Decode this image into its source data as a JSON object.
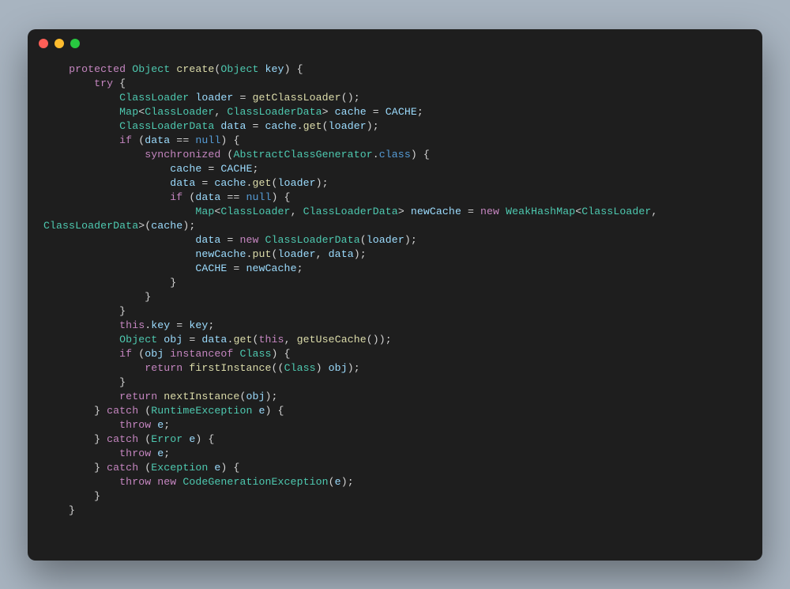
{
  "window": {
    "traffic_lights": [
      "close",
      "minimize",
      "zoom"
    ]
  },
  "code": {
    "language": "java",
    "tokens": [
      [
        [
          "    ",
          "pun"
        ],
        [
          "protected",
          "kw"
        ],
        [
          " ",
          "pun"
        ],
        [
          "Object",
          "type"
        ],
        [
          " ",
          "pun"
        ],
        [
          "create",
          "fn"
        ],
        [
          "(",
          "pun"
        ],
        [
          "Object",
          "type"
        ],
        [
          " ",
          "pun"
        ],
        [
          "key",
          "var"
        ],
        [
          ") {",
          "pun"
        ]
      ],
      [
        [
          "        ",
          "pun"
        ],
        [
          "try",
          "kw"
        ],
        [
          " {",
          "pun"
        ]
      ],
      [
        [
          "            ",
          "pun"
        ],
        [
          "ClassLoader",
          "type"
        ],
        [
          " ",
          "pun"
        ],
        [
          "loader",
          "var"
        ],
        [
          " = ",
          "pun"
        ],
        [
          "getClassLoader",
          "fn"
        ],
        [
          "();",
          "pun"
        ]
      ],
      [
        [
          "            ",
          "pun"
        ],
        [
          "Map",
          "type"
        ],
        [
          "<",
          "pun"
        ],
        [
          "ClassLoader",
          "type"
        ],
        [
          ", ",
          "pun"
        ],
        [
          "ClassLoaderData",
          "type"
        ],
        [
          "> ",
          "pun"
        ],
        [
          "cache",
          "var"
        ],
        [
          " = ",
          "pun"
        ],
        [
          "CACHE",
          "cnst"
        ],
        [
          ";",
          "pun"
        ]
      ],
      [
        [
          "            ",
          "pun"
        ],
        [
          "ClassLoaderData",
          "type"
        ],
        [
          " ",
          "pun"
        ],
        [
          "data",
          "var"
        ],
        [
          " = ",
          "pun"
        ],
        [
          "cache",
          "var"
        ],
        [
          ".",
          "pun"
        ],
        [
          "get",
          "fn"
        ],
        [
          "(",
          "pun"
        ],
        [
          "loader",
          "var"
        ],
        [
          ");",
          "pun"
        ]
      ],
      [
        [
          "            ",
          "pun"
        ],
        [
          "if",
          "kw"
        ],
        [
          " (",
          "pun"
        ],
        [
          "data",
          "var"
        ],
        [
          " == ",
          "pun"
        ],
        [
          "null",
          "null"
        ],
        [
          ") {",
          "pun"
        ]
      ],
      [
        [
          "                ",
          "pun"
        ],
        [
          "synchronized",
          "kw"
        ],
        [
          " (",
          "pun"
        ],
        [
          "AbstractClassGenerator",
          "type"
        ],
        [
          ".",
          "pun"
        ],
        [
          "class",
          "null"
        ],
        [
          ") {",
          "pun"
        ]
      ],
      [
        [
          "                    ",
          "pun"
        ],
        [
          "cache",
          "var"
        ],
        [
          " = ",
          "pun"
        ],
        [
          "CACHE",
          "cnst"
        ],
        [
          ";",
          "pun"
        ]
      ],
      [
        [
          "                    ",
          "pun"
        ],
        [
          "data",
          "var"
        ],
        [
          " = ",
          "pun"
        ],
        [
          "cache",
          "var"
        ],
        [
          ".",
          "pun"
        ],
        [
          "get",
          "fn"
        ],
        [
          "(",
          "pun"
        ],
        [
          "loader",
          "var"
        ],
        [
          ");",
          "pun"
        ]
      ],
      [
        [
          "                    ",
          "pun"
        ],
        [
          "if",
          "kw"
        ],
        [
          " (",
          "pun"
        ],
        [
          "data",
          "var"
        ],
        [
          " == ",
          "pun"
        ],
        [
          "null",
          "null"
        ],
        [
          ") {",
          "pun"
        ]
      ],
      [
        [
          "                        ",
          "pun"
        ],
        [
          "Map",
          "type"
        ],
        [
          "<",
          "pun"
        ],
        [
          "ClassLoader",
          "type"
        ],
        [
          ", ",
          "pun"
        ],
        [
          "ClassLoaderData",
          "type"
        ],
        [
          "> ",
          "pun"
        ],
        [
          "newCache",
          "var"
        ],
        [
          " = ",
          "pun"
        ],
        [
          "new",
          "kw"
        ],
        [
          " ",
          "pun"
        ],
        [
          "WeakHashMap",
          "type"
        ],
        [
          "<",
          "pun"
        ],
        [
          "ClassLoader",
          "type"
        ],
        [
          ", ",
          "pun"
        ]
      ],
      [
        [
          "ClassLoaderData",
          "type"
        ],
        [
          ">(",
          "pun"
        ],
        [
          "cache",
          "var"
        ],
        [
          ");",
          "pun"
        ]
      ],
      [
        [
          "                        ",
          "pun"
        ],
        [
          "data",
          "var"
        ],
        [
          " = ",
          "pun"
        ],
        [
          "new",
          "kw"
        ],
        [
          " ",
          "pun"
        ],
        [
          "ClassLoaderData",
          "type"
        ],
        [
          "(",
          "pun"
        ],
        [
          "loader",
          "var"
        ],
        [
          ");",
          "pun"
        ]
      ],
      [
        [
          "                        ",
          "pun"
        ],
        [
          "newCache",
          "var"
        ],
        [
          ".",
          "pun"
        ],
        [
          "put",
          "fn"
        ],
        [
          "(",
          "pun"
        ],
        [
          "loader",
          "var"
        ],
        [
          ", ",
          "pun"
        ],
        [
          "data",
          "var"
        ],
        [
          ");",
          "pun"
        ]
      ],
      [
        [
          "                        ",
          "pun"
        ],
        [
          "CACHE",
          "cnst"
        ],
        [
          " = ",
          "pun"
        ],
        [
          "newCache",
          "var"
        ],
        [
          ";",
          "pun"
        ]
      ],
      [
        [
          "                    }",
          "pun"
        ]
      ],
      [
        [
          "                }",
          "pun"
        ]
      ],
      [
        [
          "            }",
          "pun"
        ]
      ],
      [
        [
          "            ",
          "pun"
        ],
        [
          "this",
          "kw"
        ],
        [
          ".",
          "pun"
        ],
        [
          "key",
          "var"
        ],
        [
          " = ",
          "pun"
        ],
        [
          "key",
          "var"
        ],
        [
          ";",
          "pun"
        ]
      ],
      [
        [
          "            ",
          "pun"
        ],
        [
          "Object",
          "type"
        ],
        [
          " ",
          "pun"
        ],
        [
          "obj",
          "var"
        ],
        [
          " = ",
          "pun"
        ],
        [
          "data",
          "var"
        ],
        [
          ".",
          "pun"
        ],
        [
          "get",
          "fn"
        ],
        [
          "(",
          "pun"
        ],
        [
          "this",
          "kw"
        ],
        [
          ", ",
          "pun"
        ],
        [
          "getUseCache",
          "fn"
        ],
        [
          "());",
          "pun"
        ]
      ],
      [
        [
          "            ",
          "pun"
        ],
        [
          "if",
          "kw"
        ],
        [
          " (",
          "pun"
        ],
        [
          "obj",
          "var"
        ],
        [
          " ",
          "pun"
        ],
        [
          "instanceof",
          "kw"
        ],
        [
          " ",
          "pun"
        ],
        [
          "Class",
          "type"
        ],
        [
          ") {",
          "pun"
        ]
      ],
      [
        [
          "                ",
          "pun"
        ],
        [
          "return",
          "kw"
        ],
        [
          " ",
          "pun"
        ],
        [
          "firstInstance",
          "fn"
        ],
        [
          "((",
          "pun"
        ],
        [
          "Class",
          "type"
        ],
        [
          ") ",
          "pun"
        ],
        [
          "obj",
          "var"
        ],
        [
          ");",
          "pun"
        ]
      ],
      [
        [
          "            }",
          "pun"
        ]
      ],
      [
        [
          "            ",
          "pun"
        ],
        [
          "return",
          "kw"
        ],
        [
          " ",
          "pun"
        ],
        [
          "nextInstance",
          "fn"
        ],
        [
          "(",
          "pun"
        ],
        [
          "obj",
          "var"
        ],
        [
          ");",
          "pun"
        ]
      ],
      [
        [
          "        } ",
          "pun"
        ],
        [
          "catch",
          "kw"
        ],
        [
          " (",
          "pun"
        ],
        [
          "RuntimeException",
          "type"
        ],
        [
          " ",
          "pun"
        ],
        [
          "e",
          "var"
        ],
        [
          ") {",
          "pun"
        ]
      ],
      [
        [
          "            ",
          "pun"
        ],
        [
          "throw",
          "kw"
        ],
        [
          " ",
          "pun"
        ],
        [
          "e",
          "var"
        ],
        [
          ";",
          "pun"
        ]
      ],
      [
        [
          "        } ",
          "pun"
        ],
        [
          "catch",
          "kw"
        ],
        [
          " (",
          "pun"
        ],
        [
          "Error",
          "type"
        ],
        [
          " ",
          "pun"
        ],
        [
          "e",
          "var"
        ],
        [
          ") {",
          "pun"
        ]
      ],
      [
        [
          "            ",
          "pun"
        ],
        [
          "throw",
          "kw"
        ],
        [
          " ",
          "pun"
        ],
        [
          "e",
          "var"
        ],
        [
          ";",
          "pun"
        ]
      ],
      [
        [
          "        } ",
          "pun"
        ],
        [
          "catch",
          "kw"
        ],
        [
          " (",
          "pun"
        ],
        [
          "Exception",
          "type"
        ],
        [
          " ",
          "pun"
        ],
        [
          "e",
          "var"
        ],
        [
          ") {",
          "pun"
        ]
      ],
      [
        [
          "            ",
          "pun"
        ],
        [
          "throw",
          "kw"
        ],
        [
          " ",
          "pun"
        ],
        [
          "new",
          "kw"
        ],
        [
          " ",
          "pun"
        ],
        [
          "CodeGenerationException",
          "type"
        ],
        [
          "(",
          "pun"
        ],
        [
          "e",
          "var"
        ],
        [
          ");",
          "pun"
        ]
      ],
      [
        [
          "        }",
          "pun"
        ]
      ],
      [
        [
          "    }",
          "pun"
        ]
      ]
    ]
  }
}
